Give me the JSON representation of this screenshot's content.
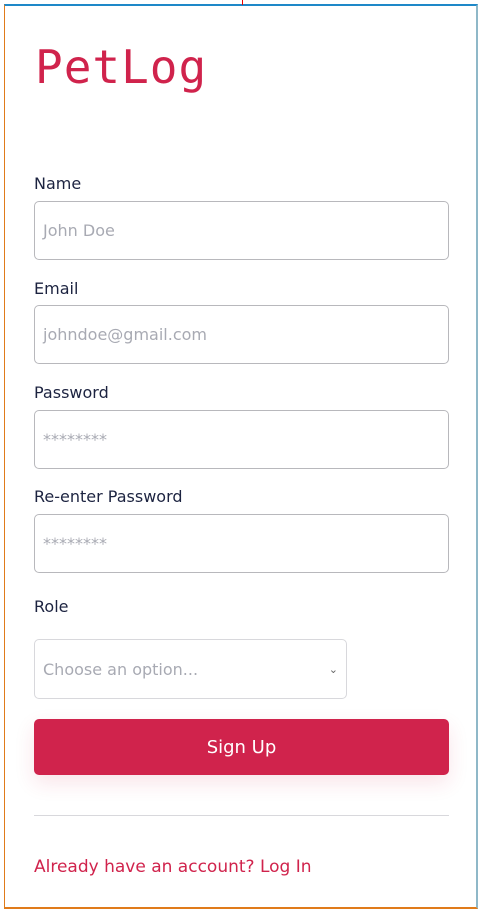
{
  "app": {
    "title": "PetLog"
  },
  "form": {
    "name": {
      "label": "Name",
      "placeholder": "John Doe"
    },
    "email": {
      "label": "Email",
      "placeholder": "johndoe@gmail.com"
    },
    "password": {
      "label": "Password",
      "placeholder": "********"
    },
    "confirm": {
      "label": "Re-enter Password",
      "placeholder": "********"
    },
    "role": {
      "label": "Role",
      "selected": "Choose an option..."
    },
    "submit_label": "Sign Up",
    "login_link": "Already have an account? Log In"
  },
  "colors": {
    "accent": "#d0234c"
  }
}
